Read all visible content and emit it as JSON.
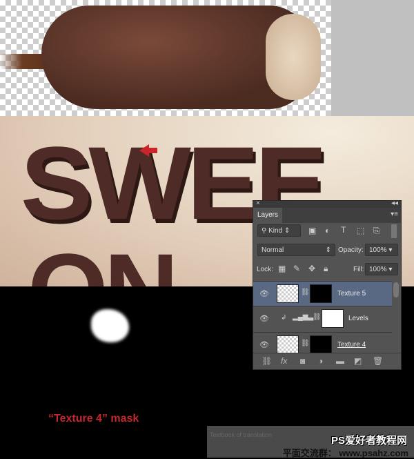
{
  "caption": "“Texture 4” mask",
  "artwork_text": {
    "line1": "SWEE",
    "line2": "ON"
  },
  "watermark": {
    "textbook": "Textbook of translation",
    "site_cn": "PS爱好者教程网",
    "site_url": "www.psahz.com",
    "group": "平面交流群："
  },
  "layers_panel": {
    "tab": "Layers",
    "filter_kind": "Kind",
    "blend_mode": "Normal",
    "opacity_label": "Opacity:",
    "opacity_value": "100%",
    "lock_label": "Lock:",
    "fill_label": "Fill:",
    "fill_value": "100%",
    "layers": [
      {
        "name": "Texture 5",
        "selected": true
      },
      {
        "name": "Levels",
        "selected": false
      },
      {
        "name": "Texture 4",
        "selected": false
      }
    ]
  },
  "colors": {
    "accent_red": "#c6262d",
    "selected_layer": "#596983"
  }
}
